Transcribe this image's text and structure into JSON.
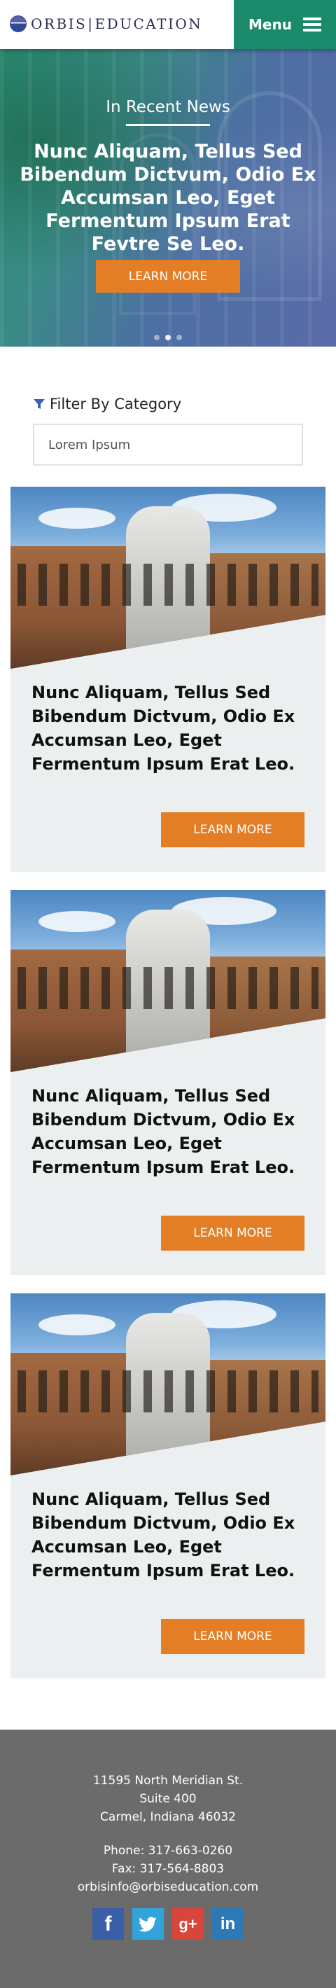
{
  "header": {
    "logo_text_left": "ORBIS",
    "logo_text_right": "EDUCATION",
    "menu_label": "Menu"
  },
  "hero": {
    "kicker": "In Recent News",
    "title": "Nunc Aliquam, Tellus Sed Bibendum Dictvum, Odio Ex Accumsan Leo, Eget Fermentum Ipsum Erat Fevtre Se Leo.",
    "button_label": "LEARN MORE",
    "slide_count": 3,
    "active_slide": 1
  },
  "filter": {
    "label": "Filter By Category",
    "selected_value": "Lorem Ipsum"
  },
  "articles": [
    {
      "title": "Nunc Aliquam, Tellus Sed Bibendum Dictvum, Odio Ex Accumsan Leo, Eget Fermentum Ipsum Erat Leo.",
      "button_label": "LEARN MORE"
    },
    {
      "title": "Nunc Aliquam, Tellus Sed Bibendum Dictvum, Odio Ex Accumsan Leo, Eget Fermentum Ipsum Erat Leo.",
      "button_label": "LEARN MORE"
    },
    {
      "title": "Nunc Aliquam, Tellus Sed Bibendum Dictvum, Odio Ex Accumsan Leo, Eget Fermentum Ipsum Erat Leo.",
      "button_label": "LEARN MORE"
    }
  ],
  "footer": {
    "address": [
      "11595 North Meridian St.",
      "Suite 400",
      "Carmel, Indiana 46032"
    ],
    "phone": "Phone: 317-663-0260",
    "fax": "Fax: 317-564-8803",
    "email": "orbisinfo@orbiseducation.com",
    "social": [
      "facebook-icon",
      "twitter-icon",
      "google-plus-icon",
      "linkedin-icon"
    ]
  },
  "colors": {
    "brand_green": "#1a8a6b",
    "accent_orange": "#e47e26",
    "footer_gray": "#6b6b6b",
    "card_bg": "#eceff0"
  }
}
